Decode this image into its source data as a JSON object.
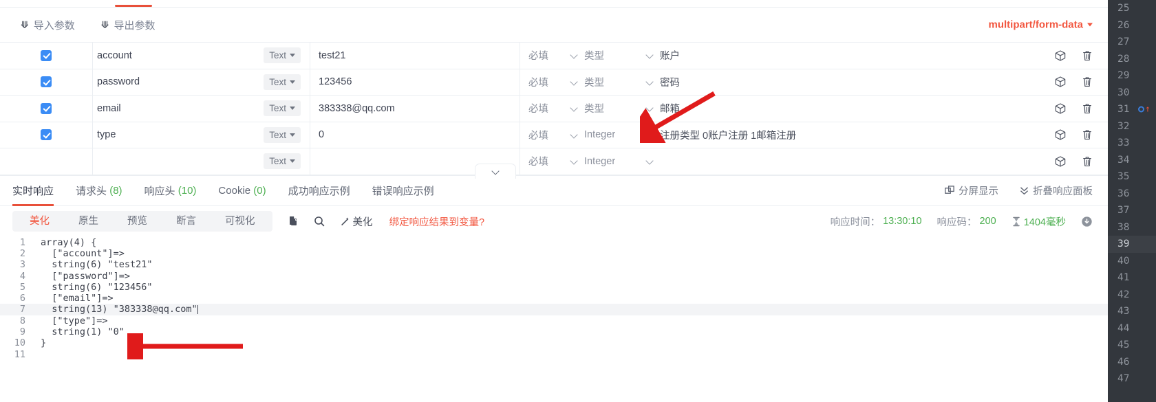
{
  "params_toolbar": {
    "import_label": "导入参数",
    "export_label": "导出参数",
    "import_icon": "arrow-up-icon",
    "export_icon": "arrow-down-icon",
    "content_type": "multipart/form-data"
  },
  "param_table": {
    "rows": [
      {
        "checked": true,
        "name": "account",
        "type": "Text",
        "value": "test21",
        "required": "必填",
        "datatype": "类型",
        "desc": "账户"
      },
      {
        "checked": true,
        "name": "password",
        "type": "Text",
        "value": "123456",
        "required": "必填",
        "datatype": "类型",
        "desc": "密码"
      },
      {
        "checked": true,
        "name": "email",
        "type": "Text",
        "value": "383338@qq.com",
        "required": "必填",
        "datatype": "类型",
        "desc": "邮箱"
      },
      {
        "checked": true,
        "name": "type",
        "type": "Text",
        "value": "0",
        "required": "必填",
        "datatype": "Integer",
        "desc": "注册类型 0账户注册  1邮箱注册"
      },
      {
        "checked": false,
        "name": "",
        "type": "Text",
        "value": "",
        "required": "必填",
        "datatype": "Integer",
        "desc": ""
      }
    ],
    "row_icons": {
      "box": "box-icon",
      "delete": "trash-icon"
    }
  },
  "collapse_handle": {
    "icon": "chevron-down-icon"
  },
  "response_tabs": {
    "tabs": [
      {
        "label": "实时响应",
        "count": "",
        "active": true
      },
      {
        "label": "请求头",
        "count": "(8)",
        "active": false
      },
      {
        "label": "响应头",
        "count": "(10)",
        "active": false
      },
      {
        "label": "Cookie",
        "count": "(0)",
        "active": false
      },
      {
        "label": "成功响应示例",
        "count": "",
        "active": false
      },
      {
        "label": "错误响应示例",
        "count": "",
        "active": false
      }
    ],
    "actions": [
      {
        "label": "分屏显示",
        "icon": "split-screen-icon"
      },
      {
        "label": "折叠响应面板",
        "icon": "chevron-double-down-icon"
      }
    ]
  },
  "body_toolbar": {
    "segments": [
      {
        "label": "美化",
        "active": true
      },
      {
        "label": "原生",
        "active": false
      },
      {
        "label": "预览",
        "active": false
      },
      {
        "label": "断言",
        "active": false
      },
      {
        "label": "可视化",
        "active": false
      }
    ],
    "icons": [
      {
        "name": "copy-icon"
      },
      {
        "name": "search-icon"
      }
    ],
    "beautify_label": "美化",
    "beautify_icon": "wand-icon",
    "bind_var_label": "绑定响应结果到变量?",
    "meta": {
      "time_label": "响应时间：",
      "time_value": "13:30:10",
      "code_label": "响应码：",
      "code_value": "200",
      "duration_icon": "hourglass-icon",
      "duration_value": "1404毫秒",
      "refresh_icon": "refresh-icon"
    }
  },
  "editor": {
    "highlight_line": 7,
    "lines": [
      {
        "n": "1",
        "text": "array(4) {"
      },
      {
        "n": "2",
        "text": "  [\"account\"]=>"
      },
      {
        "n": "3",
        "text": "  string(6) \"test21\""
      },
      {
        "n": "4",
        "text": "  [\"password\"]=>"
      },
      {
        "n": "5",
        "text": "  string(6) \"123456\""
      },
      {
        "n": "6",
        "text": "  [\"email\"]=>"
      },
      {
        "n": "7",
        "text": "  string(13) \"383338@qq.com\""
      },
      {
        "n": "8",
        "text": "  [\"type\"]=>"
      },
      {
        "n": "9",
        "text": "  string(1) \"0\""
      },
      {
        "n": "10",
        "text": "}"
      },
      {
        "n": "11",
        "text": ""
      }
    ]
  },
  "gutter": {
    "current_line": "39",
    "marker_line": "31",
    "lines": [
      "25",
      "26",
      "27",
      "28",
      "29",
      "30",
      "31",
      "32",
      "33",
      "34",
      "35",
      "36",
      "37",
      "38",
      "39",
      "40",
      "41",
      "42",
      "43",
      "44",
      "45",
      "46",
      "47"
    ]
  },
  "colors": {
    "accent_red": "#f2563f",
    "checkbox_blue": "#3b8cf5",
    "success_green": "#4caf50",
    "gutter_bg": "#33373d",
    "annotation_red": "#e01b1b"
  }
}
